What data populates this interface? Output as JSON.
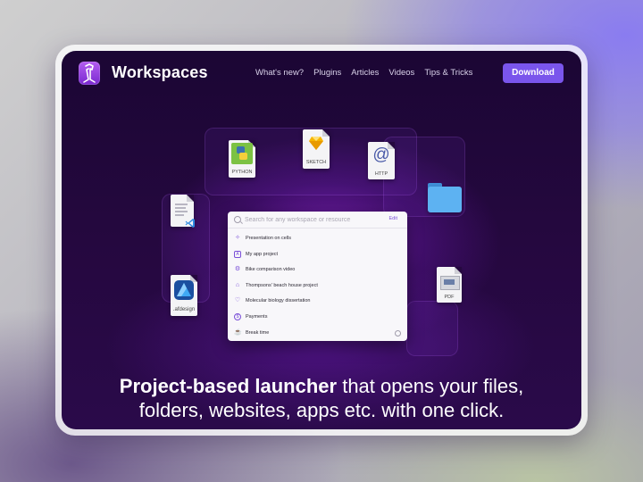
{
  "header": {
    "brand": "Workspaces",
    "nav": [
      "What's new?",
      "Plugins",
      "Articles",
      "Videos",
      "Tips & Tricks"
    ],
    "download_label": "Download"
  },
  "files": {
    "python": "PYTHON",
    "sketch": "SKETCH",
    "http": "HTTP",
    "afdesign": ".afdesign",
    "pdf": "PDF"
  },
  "launcher": {
    "search_placeholder": "Search for any workspace or resource",
    "edit_label": "Edit",
    "items": [
      {
        "label": "Presentation on cells",
        "icon": "network-icon"
      },
      {
        "label": "My app project",
        "icon": "app-store-icon"
      },
      {
        "label": "Bike comparison video",
        "icon": "bike-icon"
      },
      {
        "label": "Thompsons' beach house project",
        "icon": "house-icon"
      },
      {
        "label": "Molecular biology dissertation",
        "icon": "heart-pulse-icon"
      },
      {
        "label": "Payments",
        "icon": "dollar-icon"
      },
      {
        "label": "Break time",
        "icon": "coffee-icon"
      }
    ]
  },
  "headline": {
    "bold": "Project-based launcher",
    "rest_line1": " that opens your files,",
    "line2": "folders, websites, apps etc. with one click."
  },
  "colors": {
    "accent": "#7a55ec",
    "background_dark": "#25083f",
    "glow": "#9628dc"
  }
}
